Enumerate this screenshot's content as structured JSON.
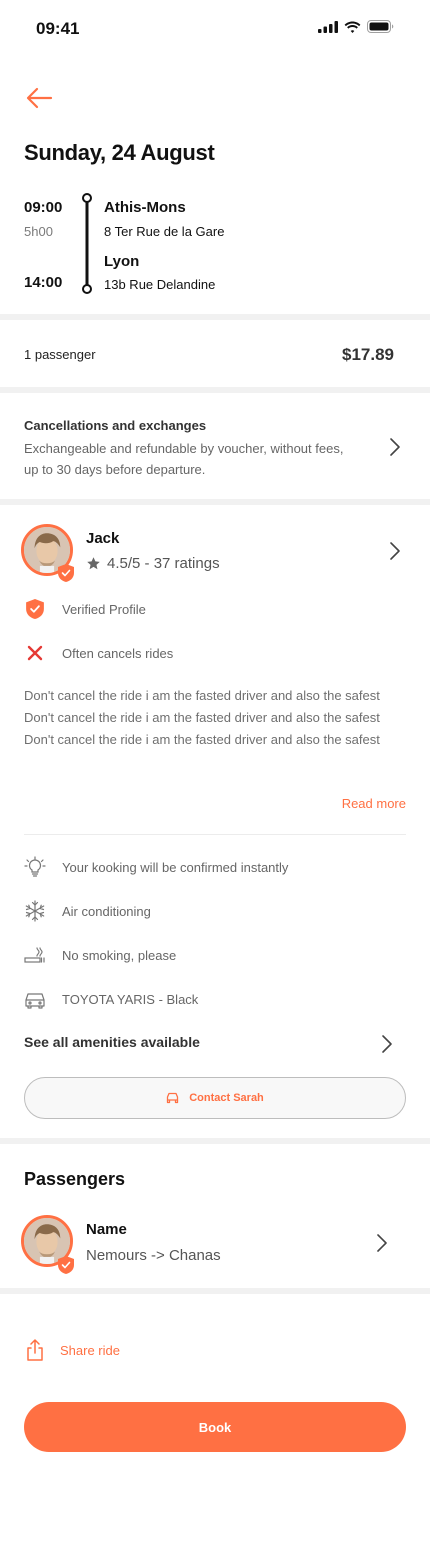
{
  "status_bar": {
    "time": "09:41"
  },
  "trip": {
    "date": "Sunday, 24 August",
    "departure_time": "09:00",
    "duration": "5h00",
    "arrival_time": "14:00",
    "origin_city": "Athis-Mons",
    "origin_address": "8 Ter Rue de la Gare",
    "destination_city": "Lyon",
    "destination_address": "13b Rue Delandine"
  },
  "booking": {
    "passengers_label": "1 passenger",
    "price": "$17.89"
  },
  "cancellation": {
    "title": "Cancellations and exchanges",
    "description": "Exchangeable and refundable by voucher, without fees, up to 30 days before departure."
  },
  "driver": {
    "name": "Jack",
    "rating": "4.5/5 - 37 ratings",
    "verified_label": "Verified Profile",
    "warning_label": "Often cancels rides",
    "bio": "Don't cancel the ride i am the fasted driver and also the safest Don't cancel the ride i am the fasted driver and also the safest Don't cancel the ride i am the fasted driver and also the safest",
    "read_more": "Read more"
  },
  "amenities": {
    "items": [
      {
        "icon": "lightbulb-icon",
        "label": "Your kooking will be confirmed instantly"
      },
      {
        "icon": "snowflake-icon",
        "label": "Air conditioning"
      },
      {
        "icon": "no-smoking-icon",
        "label": "No smoking, please"
      },
      {
        "icon": "car-icon",
        "label": "TOYOTA YARIS - Black"
      }
    ],
    "see_all": "See all amenities available"
  },
  "contact_button": "Contact Sarah",
  "passengers": {
    "title": "Passengers",
    "list": [
      {
        "name": "Name",
        "route": "Nemours -> Chanas"
      }
    ]
  },
  "share_label": "Share ride",
  "book_button": "Book",
  "colors": {
    "accent": "#ff7043",
    "warning": "#e53935",
    "separator": "#f1f1f1"
  }
}
